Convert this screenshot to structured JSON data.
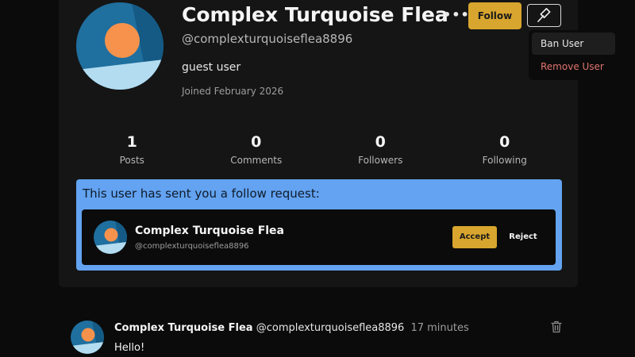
{
  "profile": {
    "display_name": "Complex Turquoise Flea",
    "handle": "@complexturquoiseflea8896",
    "bio": "guest user",
    "joined": "Joined February 2026",
    "more_label": "•••",
    "follow_label": "Follow",
    "mod_icon": "gavel-icon"
  },
  "menu": {
    "items": [
      {
        "label": "Ban User",
        "color": "#e8e8e8"
      },
      {
        "label": "Remove User",
        "color": "#e0736e"
      }
    ]
  },
  "stats": [
    {
      "value": "1",
      "label": "Posts"
    },
    {
      "value": "0",
      "label": "Comments"
    },
    {
      "value": "0",
      "label": "Followers"
    },
    {
      "value": "0",
      "label": "Following"
    }
  ],
  "follow_request": {
    "title": "This user has sent you a follow request:",
    "name": "Complex Turquoise Flea",
    "handle": "@complexturquoiseflea8896",
    "accept_label": "Accept",
    "reject_label": "Reject"
  },
  "post": {
    "author": "Complex Turquoise Flea",
    "handle": "@complexturquoiseflea8896",
    "time": "17 minutes",
    "body": "Hello!",
    "delete_icon": "trash-icon"
  },
  "colors": {
    "accent": "#d8a62e",
    "request_background": "#63a3f1",
    "avatar_blue": "#1f6f9f",
    "avatar_orange": "#f6924b",
    "danger": "#e0736e"
  }
}
